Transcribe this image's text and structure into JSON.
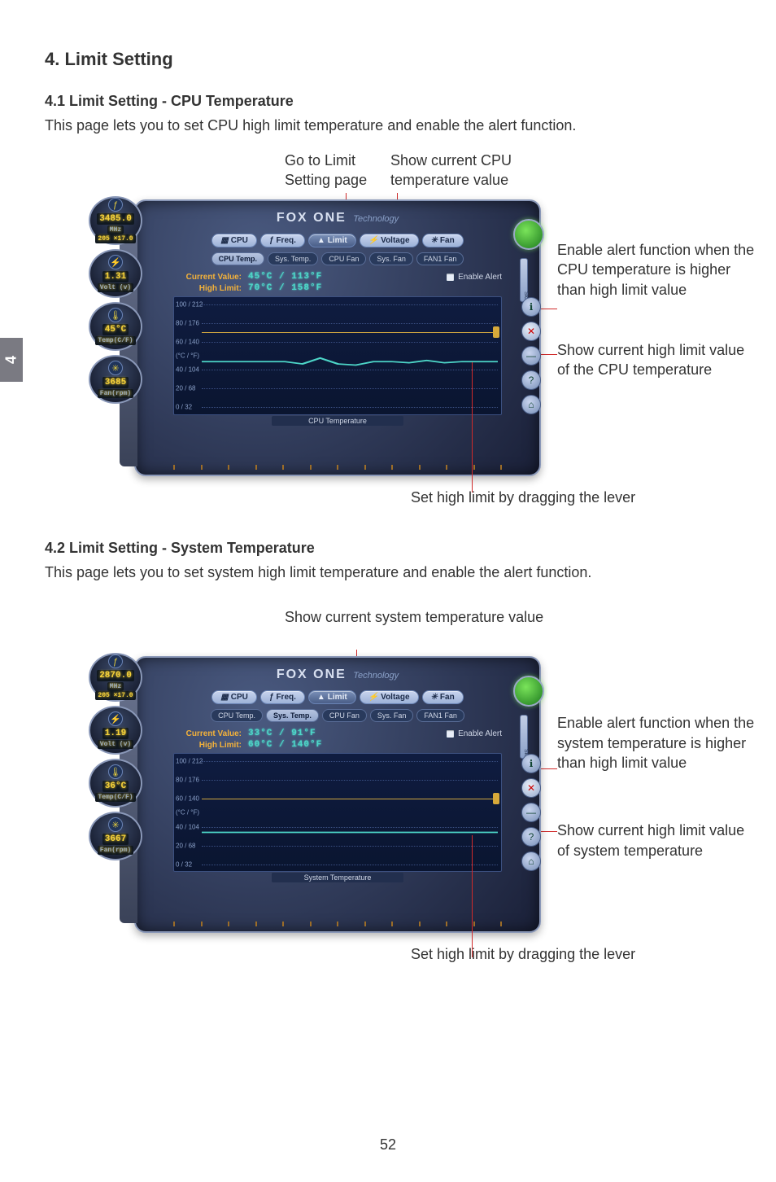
{
  "page": {
    "number": "52",
    "chapter_tab": "4"
  },
  "heading": "4. Limit Setting",
  "section1": {
    "title": "4.1 Limit Setting - CPU Temperature",
    "body": "This page lets you to set CPU high limit temperature and enable the alert function.",
    "callout_top_left": "Go to Limit\nSetting page",
    "callout_top_right": "Show current CPU\ntemperature value",
    "annot_enable": "Enable alert function when the CPU temperature is higher than high limit value",
    "annot_highlimit": "Show current high limit value of the CPU temperature",
    "annot_bottom": "Set high limit by dragging the lever"
  },
  "section2": {
    "title": "4.2 Limit Setting - System Temperature",
    "body": "This page lets you to set system high limit temperature and enable the alert function.",
    "callout_top": "Show current system temperature value",
    "annot_enable": "Enable alert function when the system temperature is higher than high limit value",
    "annot_highlimit": "Show current high limit value of system temperature",
    "annot_bottom": "Set high limit by dragging the lever"
  },
  "app": {
    "brand": "FOX ONE",
    "brand_suffix": "Technology",
    "cats": {
      "cpu": "CPU",
      "freq": "Freq.",
      "limit": "Limit",
      "voltage": "Voltage",
      "fan": "Fan"
    },
    "subtabs": {
      "cpu_temp": "CPU Temp.",
      "sys_temp": "Sys. Temp.",
      "cpu_fan": "CPU Fan",
      "sys_fan": "Sys. Fan",
      "fan1": "FAN1 Fan"
    },
    "labels": {
      "current": "Current Value:",
      "highlimit": "High Limit:",
      "enable_alert": "Enable Alert",
      "axis": "(°C / °F)"
    },
    "yticks": [
      "100 / 212",
      "80 / 176",
      "60 / 140",
      "40 / 104",
      "20 / 68",
      "0 / 32"
    ]
  },
  "panel1": {
    "gauges": {
      "mhz": "3485.0",
      "mhz_sub": "MHz",
      "fsb": "205 ×17.0",
      "volt": "1.31",
      "volt_sub": "Volt (v)",
      "temp": "45°C",
      "temp_sub": "Temp(C/F)",
      "rpm": "3685",
      "rpm_sub": "Fan(rpm)"
    },
    "current_value": "45°C / 113°F",
    "high_limit": "70°C / 158°F",
    "xlabel": "CPU Temperature"
  },
  "panel2": {
    "gauges": {
      "mhz": "2870.0",
      "mhz_sub": "MHz",
      "fsb": "205 ×17.0",
      "volt": "1.19",
      "volt_sub": "Volt (v)",
      "temp": "36°C",
      "temp_sub": "Temp(C/F)",
      "rpm": "3667",
      "rpm_sub": "Fan(rpm)"
    },
    "current_value": "33°C / 91°F",
    "high_limit": "60°C / 140°F",
    "xlabel": "System Temperature"
  },
  "chart_data": [
    {
      "type": "line",
      "title": "CPU Temperature",
      "ylabel": "(°C / °F)",
      "xlabel": "CPU Temperature",
      "ylim_c": [
        0,
        100
      ],
      "yticks_c": [
        100,
        80,
        60,
        40,
        20,
        0
      ],
      "yticks_f": [
        212,
        176,
        140,
        104,
        68,
        32
      ],
      "high_limit_c": 70,
      "series": [
        {
          "name": "CPU Temp (°C)",
          "values": [
            45,
            45,
            45,
            45,
            43,
            48,
            43,
            42,
            45,
            45,
            44,
            46,
            44,
            45,
            45,
            45,
            45
          ]
        }
      ]
    },
    {
      "type": "line",
      "title": "System Temperature",
      "ylabel": "(°C / °F)",
      "xlabel": "System Temperature",
      "ylim_c": [
        0,
        100
      ],
      "yticks_c": [
        100,
        80,
        60,
        40,
        20,
        0
      ],
      "yticks_f": [
        212,
        176,
        140,
        104,
        68,
        32
      ],
      "high_limit_c": 60,
      "series": [
        {
          "name": "Sys Temp (°C)",
          "values": [
            33,
            33,
            33,
            33,
            33,
            33,
            33,
            33,
            33,
            33,
            33,
            33,
            33,
            33,
            33,
            33,
            33
          ]
        }
      ]
    }
  ]
}
